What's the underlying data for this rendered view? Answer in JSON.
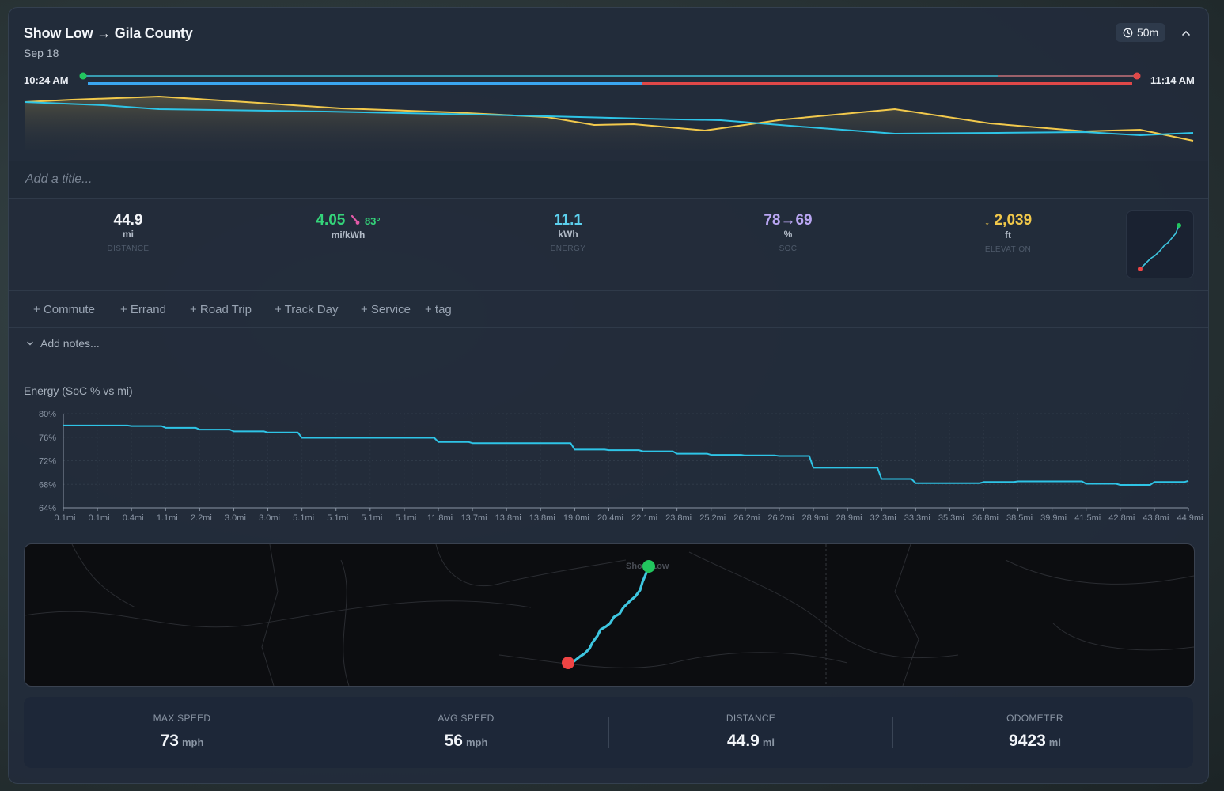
{
  "trip": {
    "title": "Show Low → Gila County",
    "date": "Sep 18",
    "duration": "50m",
    "start_time": "10:24 AM",
    "end_time": "11:14 AM",
    "title_placeholder": "Add a title..."
  },
  "stats": {
    "distance": {
      "value": "44.9",
      "unit": "mi",
      "label": "DISTANCE",
      "color": "#f4f6f9"
    },
    "efficiency": {
      "value": "4.05",
      "temp": "83°",
      "unit": "mi/kWh",
      "label": "",
      "color": "#34d47a"
    },
    "energy": {
      "value": "11.1",
      "unit": "kWh",
      "label": "ENERGY",
      "color": "#5cd0ee"
    },
    "soc": {
      "value": "78→69",
      "unit": "%",
      "label": "SOC",
      "color": "#b9a6f2"
    },
    "elevation": {
      "value": "2,039",
      "unit": "ft",
      "label": "ELEVATION",
      "color": "#f1c84a",
      "arrow": "↓"
    }
  },
  "tags": [
    "+ Commute",
    "+ Errand",
    "+ Road Trip",
    "+ Track Day",
    "+ Service",
    "+ tag"
  ],
  "notes_label": "Add notes...",
  "energy_chart_title": "Energy (SoC % vs mi)",
  "map": {
    "place_label": "Show Low",
    "start_color": "#22c55e",
    "end_color": "#ef4444",
    "route_color": "#3ec6e0"
  },
  "summary": [
    {
      "label": "MAX SPEED",
      "value": "73",
      "unit": "mph"
    },
    {
      "label": "AVG SPEED",
      "value": "56",
      "unit": "mph"
    },
    {
      "label": "DISTANCE",
      "value": "44.9",
      "unit": "mi"
    },
    {
      "label": "ODOMETER",
      "value": "9423",
      "unit": "mi"
    }
  ],
  "colors": {
    "soc_line": "#2ec4e6",
    "elevation_line": "#f2c94c",
    "speed_blue": "#3aa6f0",
    "speed_red": "#e04848",
    "track_green": "#22c55e"
  },
  "chart_data": {
    "type": "line",
    "title": "Energy (SoC % vs mi)",
    "xlabel": "",
    "ylabel": "",
    "ylim": [
      64,
      80
    ],
    "yticks": [
      "80%",
      "76%",
      "72%",
      "68%",
      "64%"
    ],
    "x_tick_labels": [
      "0.1mi",
      "0.1mi",
      "0.4mi",
      "1.1mi",
      "2.2mi",
      "3.0mi",
      "3.0mi",
      "5.1mi",
      "5.1mi",
      "5.1mi",
      "5.1mi",
      "11.8mi",
      "13.7mi",
      "13.8mi",
      "13.8mi",
      "19.0mi",
      "20.4mi",
      "22.1mi",
      "23.8mi",
      "25.2mi",
      "26.2mi",
      "26.2mi",
      "28.9mi",
      "28.9mi",
      "32.3mi",
      "33.3mi",
      "35.3mi",
      "36.8mi",
      "38.5mi",
      "39.9mi",
      "41.5mi",
      "42.8mi",
      "43.8mi",
      "44.9mi"
    ],
    "series": [
      {
        "values": [
          78.0,
          78.0,
          77.9,
          77.6,
          77.3,
          77.0,
          76.8,
          75.9,
          75.9,
          75.9,
          75.9,
          75.2,
          75.0,
          75.0,
          75.0,
          73.9,
          73.8,
          73.6,
          73.2,
          73.0,
          72.9,
          72.8,
          70.8,
          70.8,
          68.9,
          68.2,
          68.2,
          68.4,
          68.5,
          68.5,
          68.1,
          67.9,
          68.4,
          68.6
        ]
      }
    ],
    "grid": true,
    "legend": "none"
  }
}
